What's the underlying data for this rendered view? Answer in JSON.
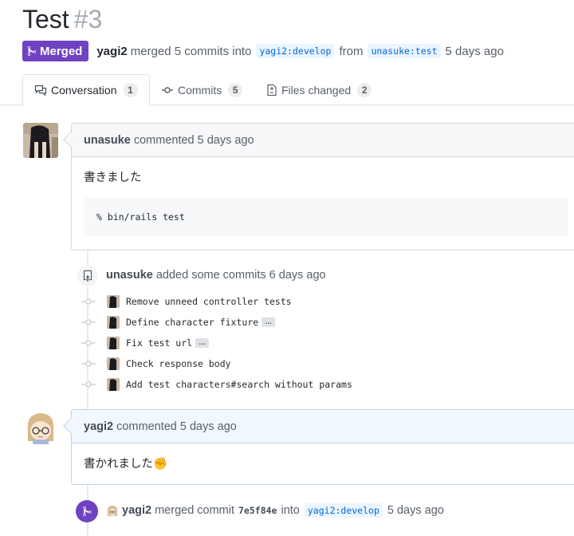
{
  "pr": {
    "title": "Test",
    "number": "#3",
    "state_label": "Merged",
    "author": "yagi2",
    "summary_pre": "merged 5 commits into",
    "base_branch": "yagi2:develop",
    "from_label": "from",
    "head_branch": "unasuke:test",
    "time": "5 days ago"
  },
  "tabs": [
    {
      "label": "Conversation",
      "count": "1",
      "icon": "comment-discussion-icon"
    },
    {
      "label": "Commits",
      "count": "5",
      "icon": "git-commit-icon"
    },
    {
      "label": "Files changed",
      "count": "2",
      "icon": "file-diff-icon"
    }
  ],
  "comment1": {
    "author": "unasuke",
    "action": "commented 5 days ago",
    "body": "書きました",
    "code": "% bin/rails test"
  },
  "commits_event": {
    "author": "unasuke",
    "action": "added some commits 6 days ago",
    "commits": [
      {
        "message": "Remove unneed controller tests",
        "has_more": false
      },
      {
        "message": "Define character fixture",
        "has_more": true
      },
      {
        "message": "Fix test url",
        "has_more": true
      },
      {
        "message": "Check response body",
        "has_more": false
      },
      {
        "message": "Add test characters#search without params",
        "has_more": false
      }
    ],
    "ellipsis": "…"
  },
  "comment2": {
    "author": "yagi2",
    "action": "commented 5 days ago",
    "body": "書かれました",
    "emoji": "✊"
  },
  "merge_event": {
    "author": "yagi2",
    "action_pre": "merged commit",
    "sha": "7e5f84e",
    "into_label": "into",
    "branch": "yagi2:develop",
    "time": "5 days ago"
  },
  "colors": {
    "merged": "#6f42c1",
    "branch_bg": "#eaf5ff",
    "branch_fg": "#0366d6"
  }
}
